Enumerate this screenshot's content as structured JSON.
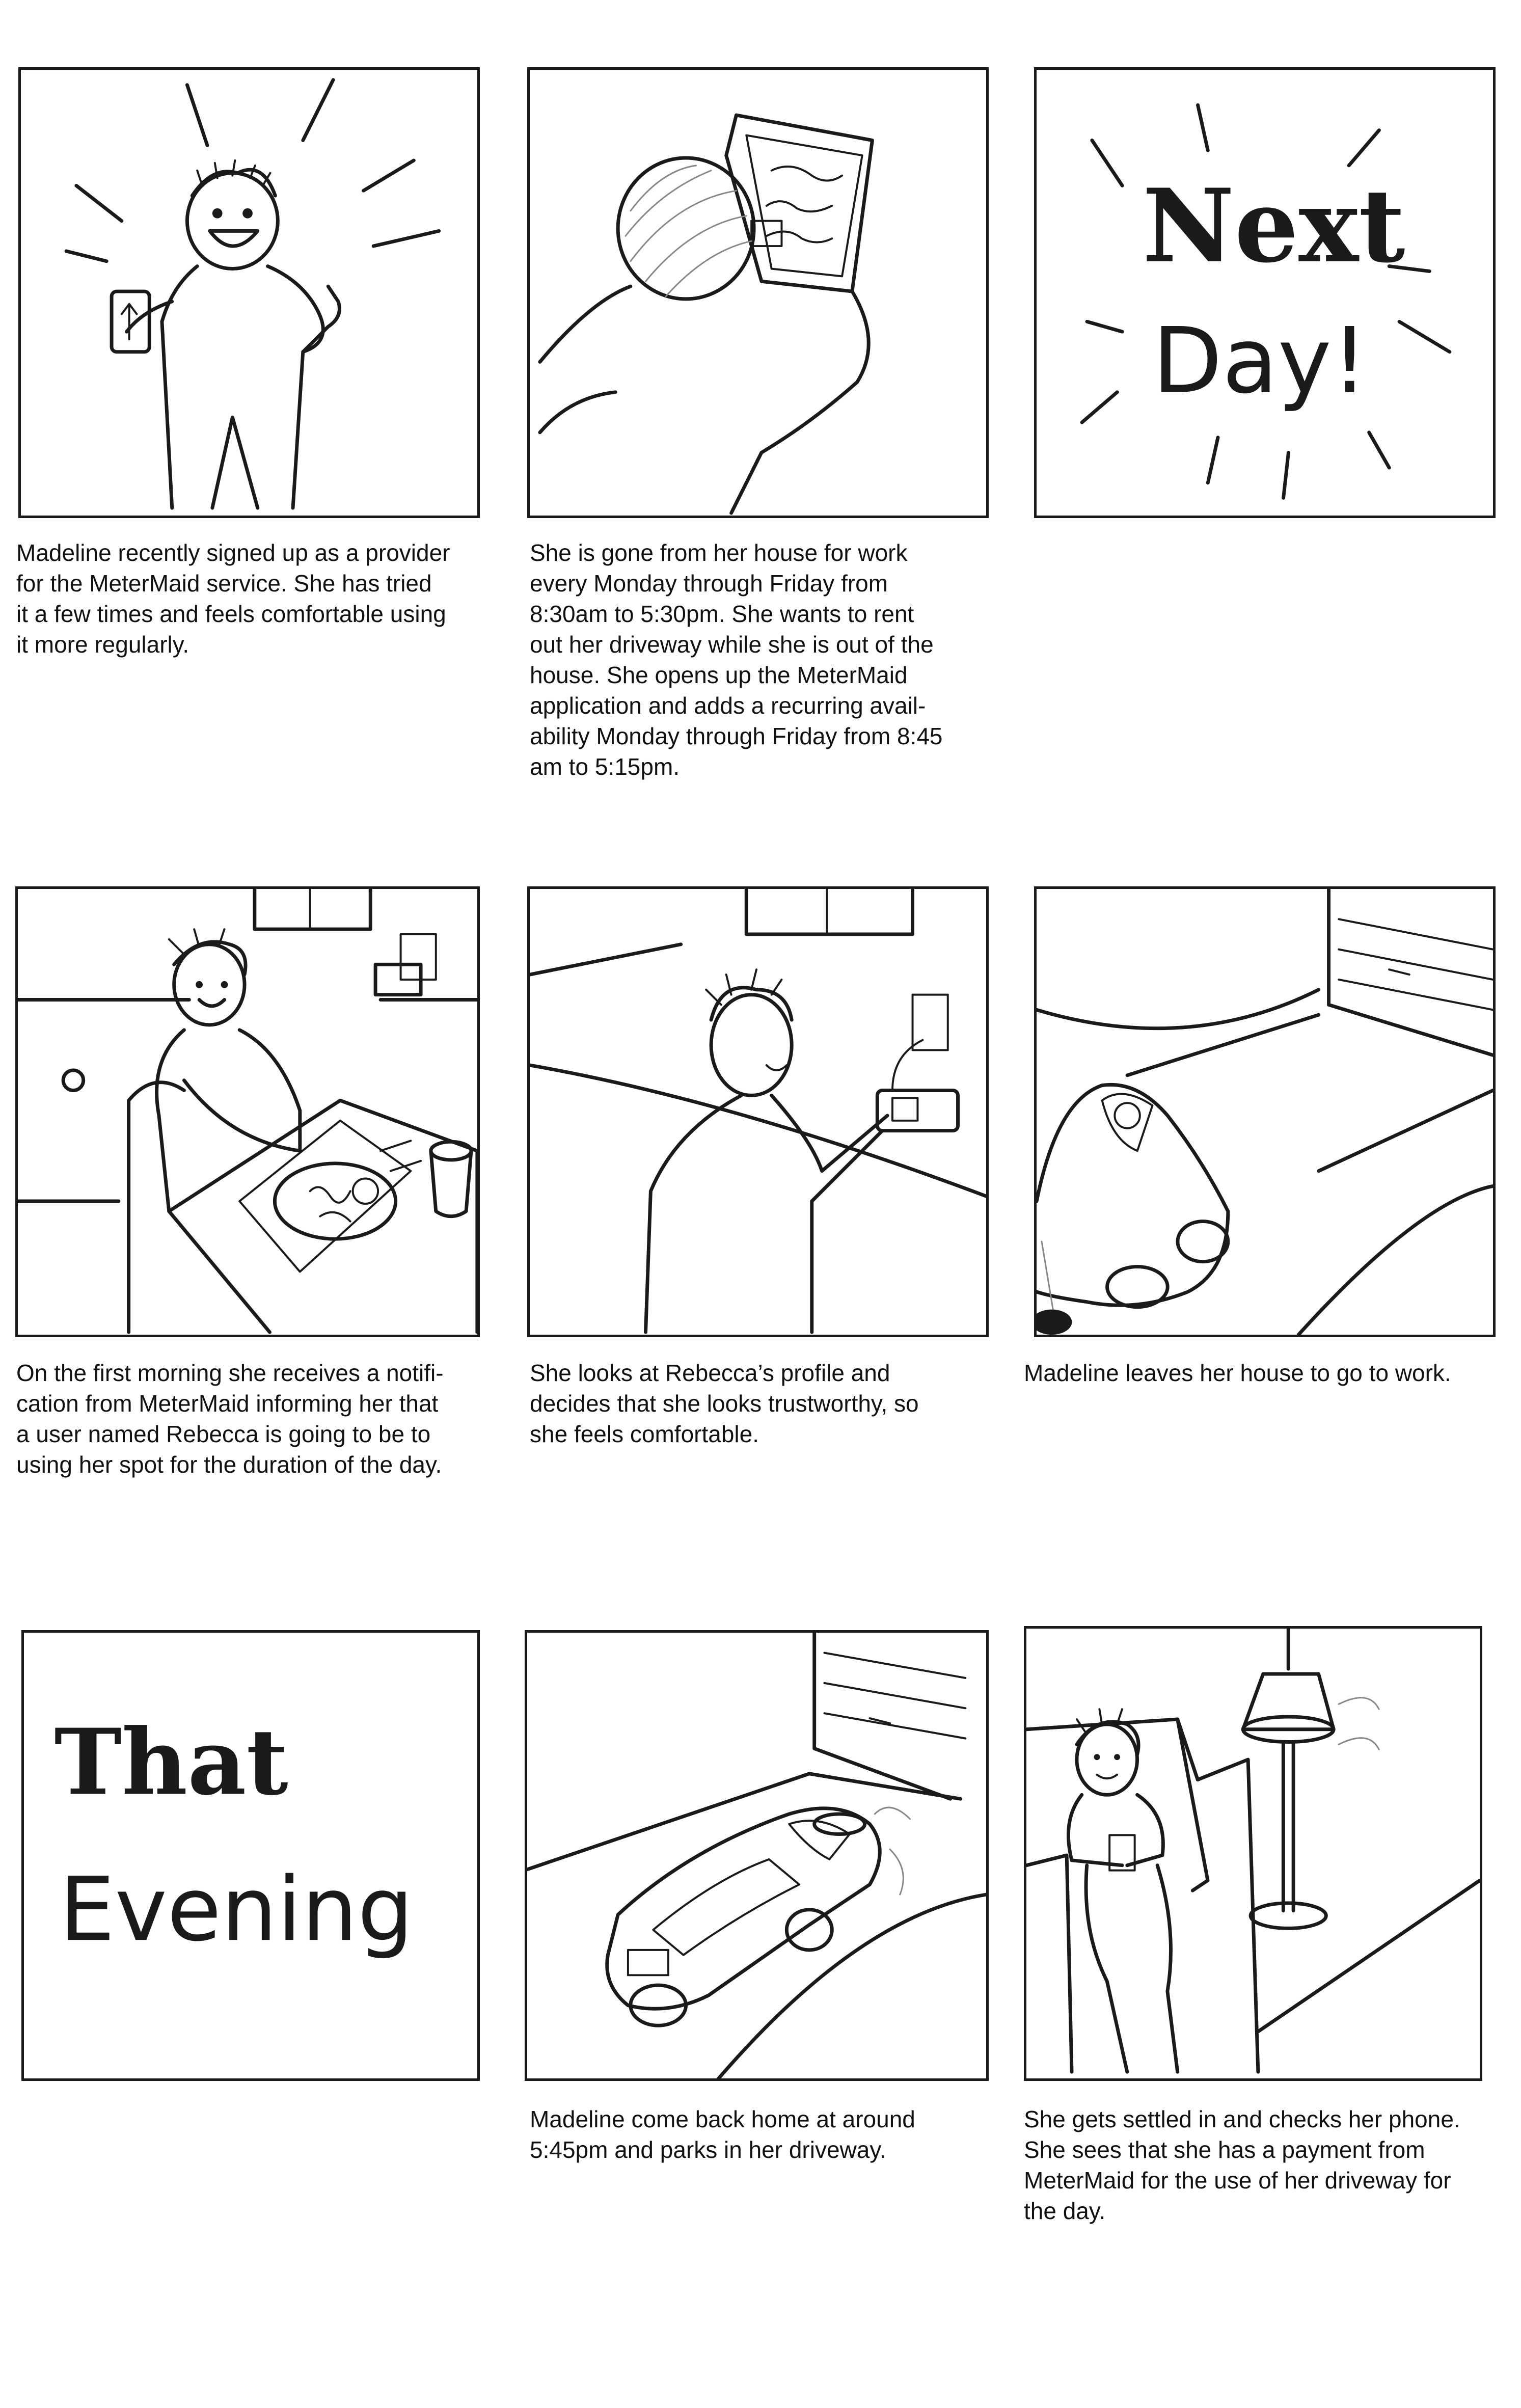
{
  "colors": {
    "ink": "#1a1a1a",
    "paper": "#ffffff",
    "shading": "#888888"
  },
  "panels": [
    {
      "caption": "Madeline recently signed up as a provider\nfor the MeterMaid service. She has tried\nit a few times and feels comfortable using\nit more regularly."
    },
    {
      "caption": "She is gone from her house for work\nevery Monday through Friday from\n8:30am to 5:30pm. She wants to rent\nout her driveway while she is out of the\nhouse. She opens up the MeterMaid\napplication and adds a recurring avail-\nability Monday through Friday from 8:45\nam to 5:15pm."
    },
    {
      "title_line_1": "Next",
      "title_line_2": "Day!",
      "caption": ""
    },
    {
      "caption": "On the first morning she receives a notifi-\ncation from MeterMaid informing her that\na user named Rebecca is going to be to\nusing her spot for the duration of the day."
    },
    {
      "caption": "She looks at Rebecca’s profile and\ndecides that she looks trustworthy, so\nshe feels comfortable."
    },
    {
      "caption": "Madeline leaves her house to go to work."
    },
    {
      "title_line_1": "That",
      "title_line_2": "Evening",
      "caption": ""
    },
    {
      "caption": "Madeline come back home at around\n5:45pm and parks in her driveway."
    },
    {
      "caption": "She gets settled in and checks her phone.\nShe sees that she has a payment from\nMeterMaid for the use of her driveway for\nthe day."
    }
  ]
}
